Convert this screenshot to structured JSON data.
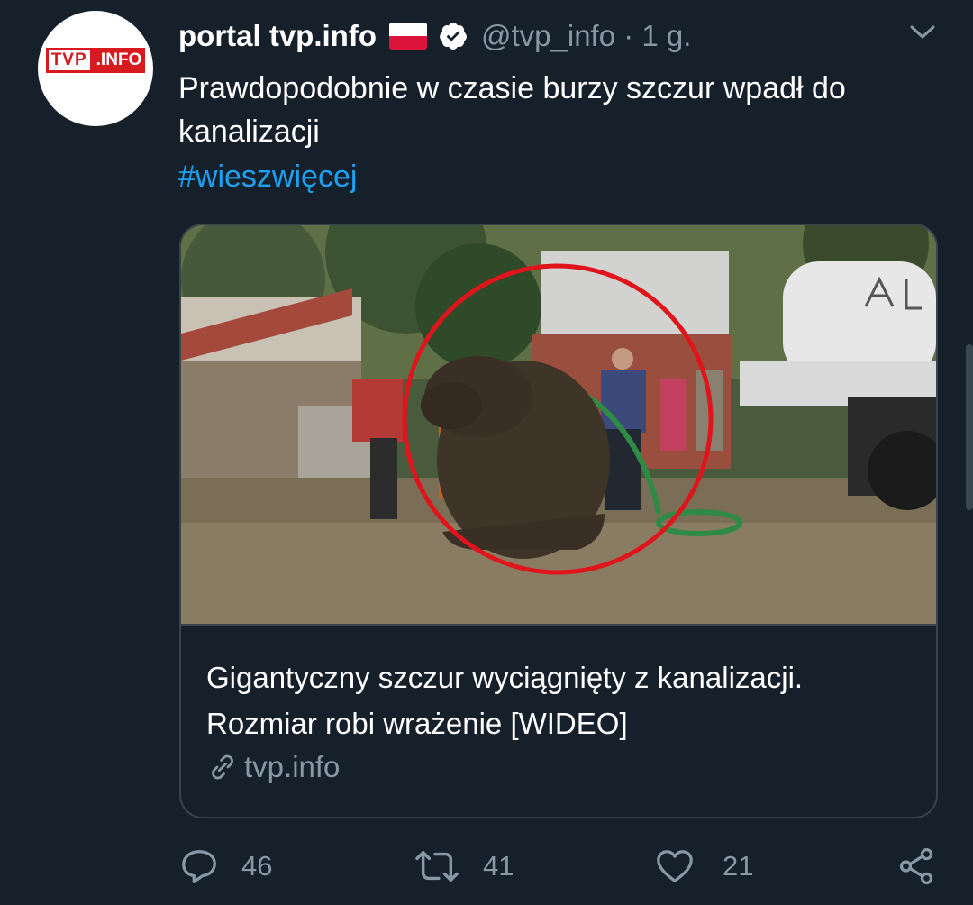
{
  "tweet": {
    "avatar_logo": {
      "left": "TVP",
      "right": ".INFO"
    },
    "display_name": "portal tvp.info",
    "handle": "@tvp_info · 1 g.",
    "text": "Prawdopodobnie w czasie burzy szczur wpadł do kanalizacji",
    "hashtag": "#wieszwięcej",
    "flag_icon": "poland-flag-icon",
    "verified_icon": "verified-badge-icon",
    "menu_icon": "chevron-down-icon"
  },
  "card": {
    "image_icon": "news-photo-giant-rat",
    "title": "Gigantyczny szczur wyciągnięty z kanalizacji. Rozmiar robi wrażenie [WIDEO]",
    "domain": "tvp.info",
    "link_icon": "link-icon"
  },
  "actions": {
    "reply": {
      "icon": "reply-icon",
      "count": "46"
    },
    "retweet": {
      "icon": "retweet-icon",
      "count": "41"
    },
    "like": {
      "icon": "heart-icon",
      "count": "21"
    },
    "share": {
      "icon": "share-icon"
    }
  },
  "colors": {
    "background": "#15202b",
    "accent_blue": "#1da1f2",
    "secondary_text": "#8899a6",
    "border": "#38444d",
    "brand_red": "#d71920"
  }
}
